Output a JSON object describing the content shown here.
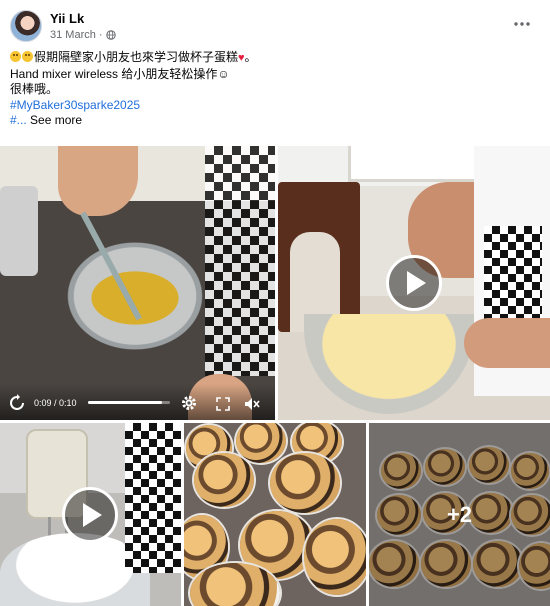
{
  "post": {
    "author": "Yii Lk",
    "date": "31 March",
    "text_line1": "假期隔壁家小朋友也來学习做杯子蛋糕",
    "text_line2": "Hand mixer wireless 给小朋友轻松操作",
    "text_line3": "很棒哦。",
    "hashtag": "#MyBaker30sparke2025",
    "hashtag2": "#...",
    "see_more": "See more"
  },
  "video": {
    "time": "0:09 / 0:10",
    "progress": 0.9
  },
  "media": {
    "more_count": "+2"
  },
  "colors": {
    "link": "#216fdb",
    "secondary_text": "#65676b",
    "heart": "#e41e3f"
  },
  "icons": [
    "globe-icon",
    "more-options-icon",
    "replay-icon",
    "settings-icon",
    "fullscreen-icon",
    "volume-muted-icon",
    "play-icon"
  ]
}
